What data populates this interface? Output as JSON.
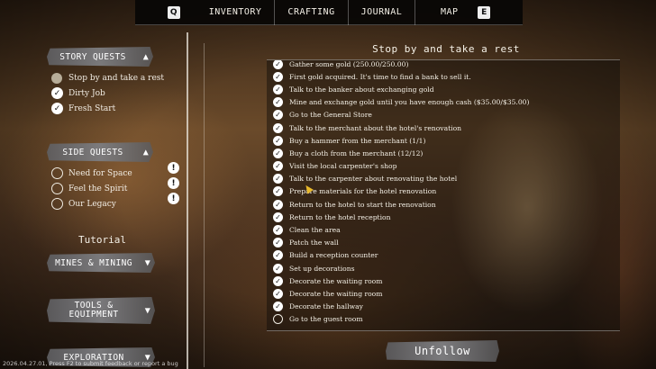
{
  "nav": {
    "key_left": "Q",
    "key_right": "E",
    "tabs": [
      "INVENTORY",
      "CRAFTING",
      "JOURNAL",
      "MAP"
    ]
  },
  "story": {
    "header": "STORY QUESTS",
    "arrow": "▲",
    "items": [
      {
        "label": "Stop by and take a rest",
        "state": "active"
      },
      {
        "label": "Dirty Job",
        "state": "done"
      },
      {
        "label": "Fresh Start",
        "state": "done"
      }
    ]
  },
  "side": {
    "header": "SIDE QUESTS",
    "arrow": "▲",
    "items": [
      {
        "label": "Need for Space",
        "badge": "!"
      },
      {
        "label": "Feel the Spirit",
        "badge": "!"
      },
      {
        "label": "Our Legacy",
        "badge": "!"
      }
    ]
  },
  "tutorial": {
    "title": "Tutorial",
    "sections": [
      {
        "label": "MINES & MINING",
        "arrow": "▼"
      },
      {
        "label_line1": "TOOLS &",
        "label_line2": "EQUIPMENT",
        "arrow": "▼"
      },
      {
        "label": "EXPLORATION",
        "arrow": "▼"
      }
    ]
  },
  "quest": {
    "title": "Stop by and take a rest",
    "tasks": [
      {
        "text": "Gather some gold (250.00/250.00)",
        "done": true
      },
      {
        "text": "First gold acquired. It's time to find a bank to sell it.",
        "done": true
      },
      {
        "text": "Talk to the banker about exchanging gold",
        "done": true
      },
      {
        "text": "Mine and exchange gold until you have enough cash ($35.00/$35.00)",
        "done": true
      },
      {
        "text": "Go to the General Store",
        "done": true
      },
      {
        "text": "Talk to the merchant about the hotel's renovation",
        "done": true
      },
      {
        "text": "Buy a hammer from the merchant (1/1)",
        "done": true
      },
      {
        "text": "Buy a cloth from the merchant (12/12)",
        "done": true
      },
      {
        "text": "Visit the local carpenter's shop",
        "done": true
      },
      {
        "text": "Talk to the carpenter about renovating the hotel",
        "done": true
      },
      {
        "text": "Prepare materials for the hotel renovation",
        "done": true
      },
      {
        "text": "Return to the hotel to start the renovation",
        "done": true
      },
      {
        "text": "Return to the hotel reception",
        "done": true
      },
      {
        "text": "Clean the area",
        "done": true
      },
      {
        "text": "Patch the wall",
        "done": true
      },
      {
        "text": "Build a reception counter",
        "done": true
      },
      {
        "text": "Set up decorations",
        "done": true
      },
      {
        "text": "Decorate the waiting room",
        "done": true
      },
      {
        "text": "Decorate the waiting room",
        "done": true
      },
      {
        "text": "Decorate the hallway",
        "done": true
      },
      {
        "text": "Go to the guest room",
        "done": false
      }
    ],
    "unfollow_label": "Unfollow"
  },
  "footer": {
    "text": "2026.04.27.01, Press F2 to submit feedback or report a bug"
  },
  "icons": {
    "check": "check-icon",
    "exclamation": "exclamation-icon",
    "chevron": "chevron-icon"
  }
}
